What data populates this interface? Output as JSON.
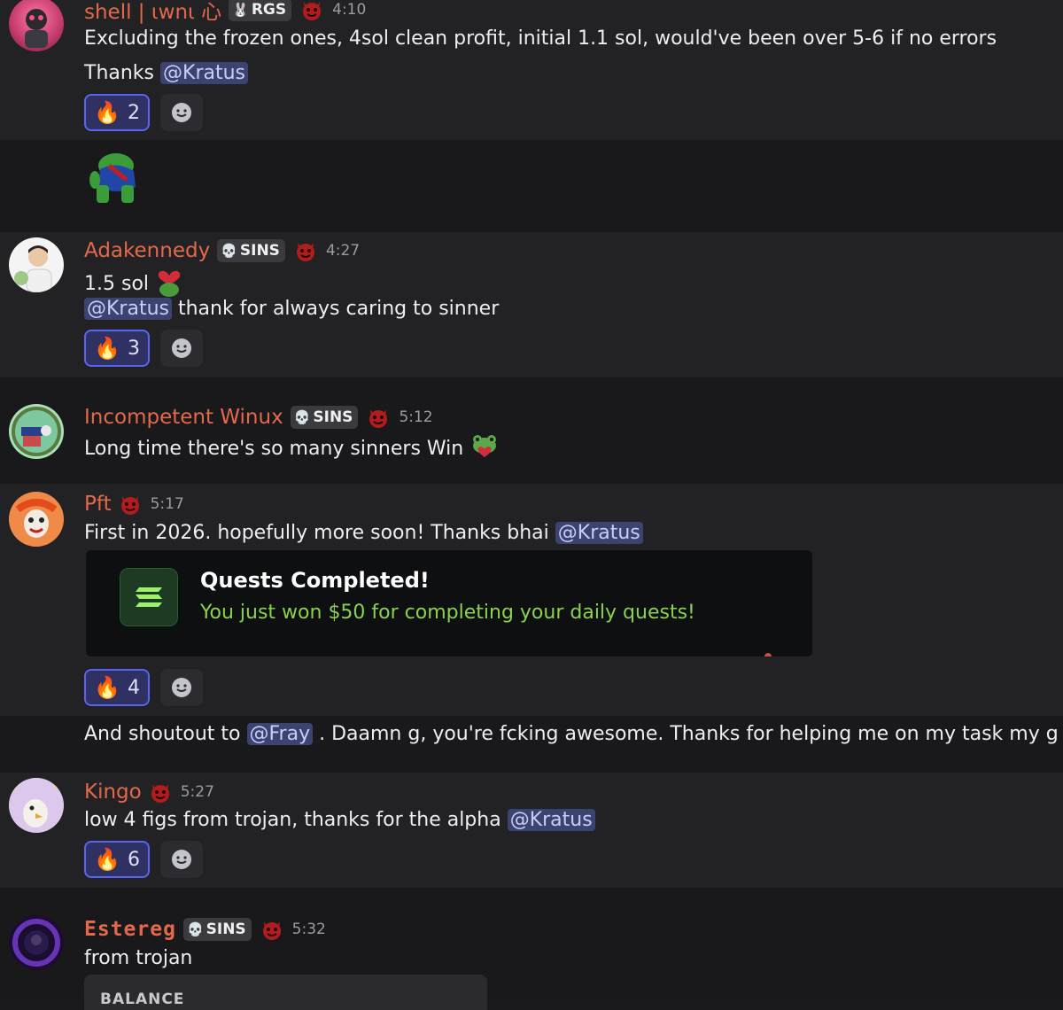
{
  "messages": [
    {
      "username": "shell | ιwnι 心",
      "tag": "RGS",
      "time": "4:10",
      "lines": [
        "Excluding the frozen ones, 4sol clean profit, initial 1.1 sol, would've been over 5-6 if no errors"
      ],
      "thanks_prefix": "Thanks",
      "mention": "@Kratus",
      "reaction_count": "2"
    },
    {
      "username": "Adakennedy",
      "tag": "SINS",
      "time": "4:27",
      "line1": "1.5 sol",
      "mention": "@Kratus",
      "line2_suffix": "thank for always caring to sinner",
      "reaction_count": "3"
    },
    {
      "username": "Incompetent Winux",
      "tag": "SINS",
      "time": "5:12",
      "line1": "Long time there's so many sinners Win"
    },
    {
      "username": "Pft",
      "time": "5:17",
      "line1_prefix": "First in 2026. hopefully more soon! Thanks bhai",
      "mention": "@Kratus",
      "embed_title": "Quests Completed!",
      "embed_desc": "You just won $50 for completing your daily quests!",
      "reaction_count": "4",
      "follow_prefix": "And shoutout to",
      "follow_mention": "@Fray",
      "follow_suffix": ". Daamn g, you're fcking awesome. Thanks for helping me on my task my g"
    },
    {
      "username": "Kingo",
      "time": "5:27",
      "line1_prefix": "low 4 figs from trojan, thanks for the alpha",
      "mention": "@Kratus",
      "reaction_count": "6"
    },
    {
      "username": "Estereg",
      "tag": "SINS",
      "time": "5:32",
      "line1": "from trojan",
      "balance_label": "BALANCE"
    }
  ],
  "colors": {
    "username": "#e4694a",
    "mention_bg": "#3c4370",
    "reaction_border": "#5865f2",
    "embed_desc": "#8bd14f"
  },
  "icons": [
    "fire-icon",
    "add-reaction-icon",
    "devil-icon",
    "skull-icon",
    "bunny-icon",
    "heart-icon",
    "frog-icon"
  ]
}
